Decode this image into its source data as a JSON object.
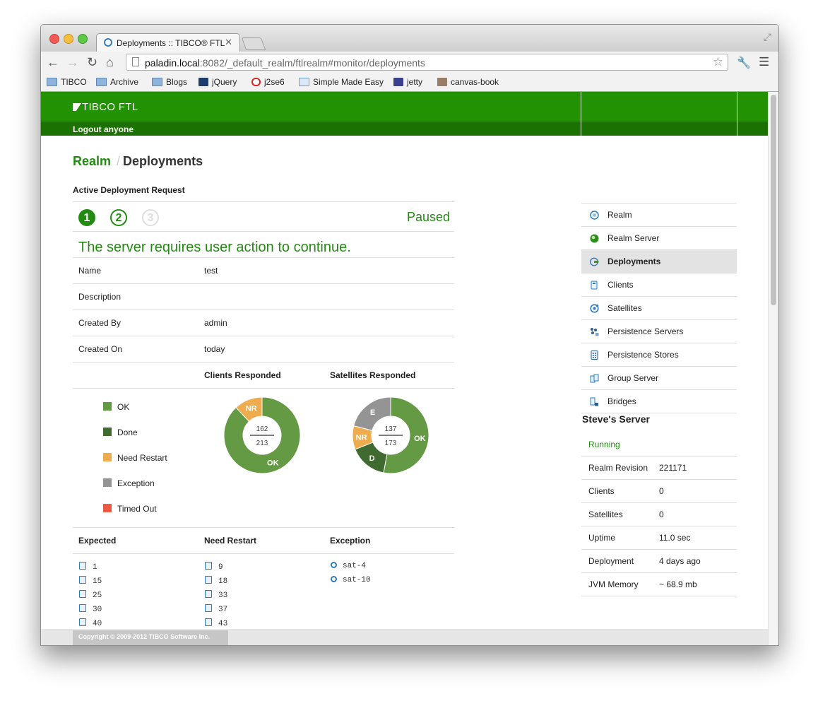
{
  "browser": {
    "tab_title": "Deployments :: TIBCO® FTL",
    "url_host": "paladin.local",
    "url_rest": ":8082/_default_realm/ftlrealm#monitor/deployments",
    "bookmarks": [
      "TIBCO",
      "Archive",
      "Blogs",
      "jQuery",
      "j2se6",
      "Simple Made Easy",
      "jetty",
      "canvas-book"
    ]
  },
  "header": {
    "logo": "TIBCO FTL",
    "logout": "Logout anyone"
  },
  "breadcrumb": {
    "realm": "Realm",
    "separator": "/",
    "current": "Deployments"
  },
  "deployment": {
    "section_title": "Active Deployment Request",
    "steps": [
      "1",
      "2",
      "3"
    ],
    "status": "Paused",
    "message": "The server requires user action to continue.",
    "fields": [
      {
        "label": "Name",
        "value": "test"
      },
      {
        "label": "Description",
        "value": ""
      },
      {
        "label": "Created By",
        "value": "admin"
      },
      {
        "label": "Created On",
        "value": "today"
      }
    ],
    "clients_responded_label": "Clients Responded",
    "satellites_responded_label": "Satellites Responded",
    "legend": [
      {
        "label": "OK",
        "color": "#659a45"
      },
      {
        "label": "Done",
        "color": "#3f6a30"
      },
      {
        "label": "Need Restart",
        "color": "#efac4f"
      },
      {
        "label": "Exception",
        "color": "#949494"
      },
      {
        "label": "Timed Out",
        "color": "#ee5a46"
      }
    ],
    "columns": {
      "expected": "Expected",
      "need_restart": "Need Restart",
      "exception": "Exception"
    },
    "expected": [
      "1",
      "15",
      "25",
      "30",
      "40"
    ],
    "need_restart": [
      "9",
      "18",
      "33",
      "37",
      "43"
    ],
    "exception": [
      "sat-4",
      "sat-10"
    ]
  },
  "chart_data": [
    {
      "type": "pie",
      "title": "Clients Responded",
      "center_top": "162",
      "center_bottom": "213",
      "slices": [
        {
          "label": "OK",
          "value": 0.88,
          "color": "#659a45"
        },
        {
          "label": "NR",
          "value": 0.12,
          "color": "#efac4f"
        }
      ]
    },
    {
      "type": "pie",
      "title": "Satellites Responded",
      "center_top": "137",
      "center_bottom": "173",
      "slices": [
        {
          "label": "OK",
          "value": 0.53,
          "color": "#659a45"
        },
        {
          "label": "D",
          "value": 0.16,
          "color": "#3f6a30"
        },
        {
          "label": "NR",
          "value": 0.1,
          "color": "#efac4f"
        },
        {
          "label": "E",
          "value": 0.21,
          "color": "#949494"
        }
      ]
    }
  ],
  "sidebar": {
    "items": [
      {
        "label": "Realm",
        "icon": "realm-icon"
      },
      {
        "label": "Realm Server",
        "icon": "realm-server-icon"
      },
      {
        "label": "Deployments",
        "icon": "deployments-icon",
        "active": true
      },
      {
        "label": "Clients",
        "icon": "clients-icon"
      },
      {
        "label": "Satellites",
        "icon": "satellites-icon"
      },
      {
        "label": "Persistence Servers",
        "icon": "persistence-servers-icon"
      },
      {
        "label": "Persistence Stores",
        "icon": "persistence-stores-icon"
      },
      {
        "label": "Group Server",
        "icon": "group-server-icon"
      },
      {
        "label": "Bridges",
        "icon": "bridges-icon"
      }
    ]
  },
  "server": {
    "title": "Steve's Server",
    "status": "Running",
    "rows": [
      {
        "label": "Realm Revision",
        "value": "221171"
      },
      {
        "label": "Clients",
        "value": "0"
      },
      {
        "label": "Satellites",
        "value": "0"
      },
      {
        "label": "Uptime",
        "value": "11.0 sec"
      },
      {
        "label": "Deployment",
        "value": "4 days ago"
      },
      {
        "label": "JVM Memory",
        "value": "~ 68.9 mb"
      }
    ]
  },
  "footer": {
    "copyright": "Copyright © 2009-2012 TIBCO Software Inc."
  }
}
